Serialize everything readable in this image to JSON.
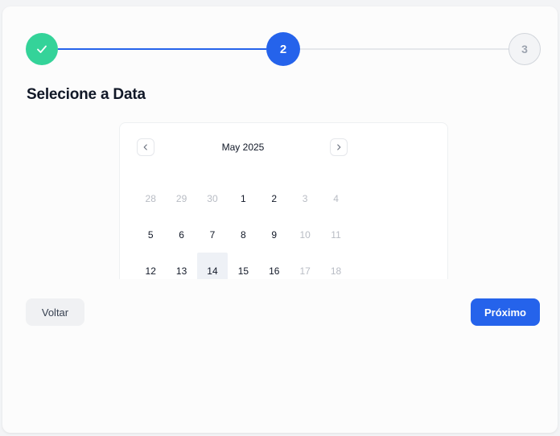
{
  "stepper": {
    "step2_label": "2",
    "step3_label": "3",
    "colors": {
      "done": "#34d399",
      "active": "#2563eb",
      "pending": "#f3f4f6"
    }
  },
  "heading": "Selecione a Data",
  "calendar": {
    "month_label": "May 2025",
    "prev_icon": "chevron-left-icon",
    "next_icon": "chevron-right-icon",
    "selected_day": "14",
    "days": [
      {
        "label": "28",
        "muted": true
      },
      {
        "label": "29",
        "muted": true
      },
      {
        "label": "30",
        "muted": true
      },
      {
        "label": "1",
        "muted": false
      },
      {
        "label": "2",
        "muted": false
      },
      {
        "label": "3",
        "muted": true
      },
      {
        "label": "4",
        "muted": true
      },
      {
        "label": "5",
        "muted": false
      },
      {
        "label": "6",
        "muted": false
      },
      {
        "label": "7",
        "muted": false
      },
      {
        "label": "8",
        "muted": false
      },
      {
        "label": "9",
        "muted": false
      },
      {
        "label": "10",
        "muted": true
      },
      {
        "label": "11",
        "muted": true
      },
      {
        "label": "12",
        "muted": false
      },
      {
        "label": "13",
        "muted": false
      },
      {
        "label": "14",
        "muted": false,
        "selected": true
      },
      {
        "label": "15",
        "muted": false
      },
      {
        "label": "16",
        "muted": false
      },
      {
        "label": "17",
        "muted": true
      },
      {
        "label": "18",
        "muted": true
      }
    ]
  },
  "actions": {
    "back_label": "Voltar",
    "next_label": "Próximo"
  }
}
